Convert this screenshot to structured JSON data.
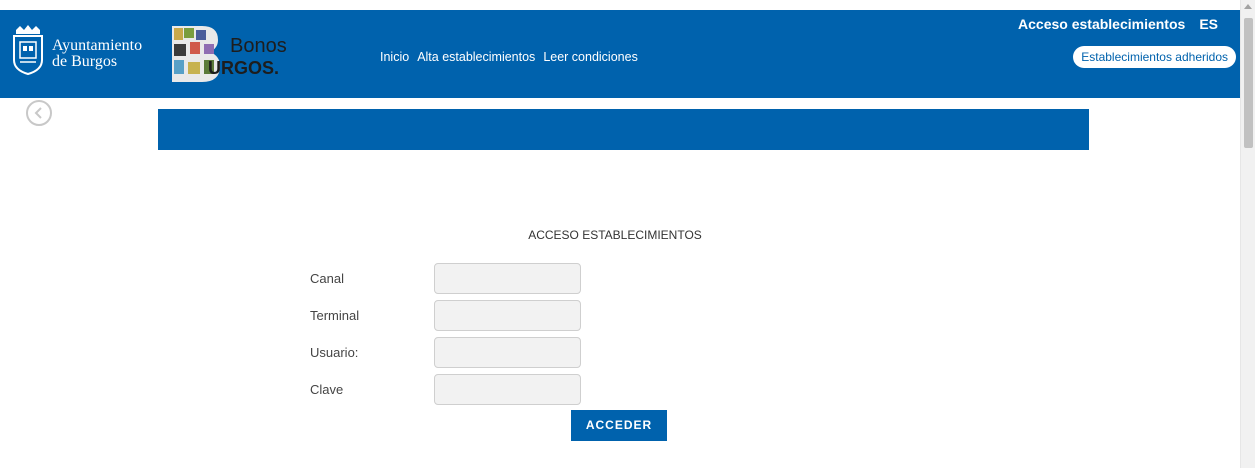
{
  "header": {
    "city_logo_line1": "Ayuntamiento",
    "city_logo_line2": "de Burgos",
    "bonos_logo_word1": "Bonos",
    "bonos_logo_word2": "URGOS.",
    "nav": [
      "Inicio",
      "Alta establecimientos",
      "Leer condiciones"
    ],
    "acceso_title": "Acceso establecimientos",
    "language": "ES",
    "adheridos_button": "Establecimientos adheridos"
  },
  "back_button_icon": "chevron-left-icon",
  "form": {
    "title": "ACCESO ESTABLECIMIENTOS",
    "fields": [
      {
        "label": "Canal",
        "value": ""
      },
      {
        "label": "Terminal",
        "value": ""
      },
      {
        "label": "Usuario:",
        "value": ""
      },
      {
        "label": "Clave",
        "value": ""
      }
    ],
    "submit_label": "ACCEDER"
  },
  "colors": {
    "brand_blue": "#0062ad",
    "field_bg": "#f2f2f2"
  }
}
